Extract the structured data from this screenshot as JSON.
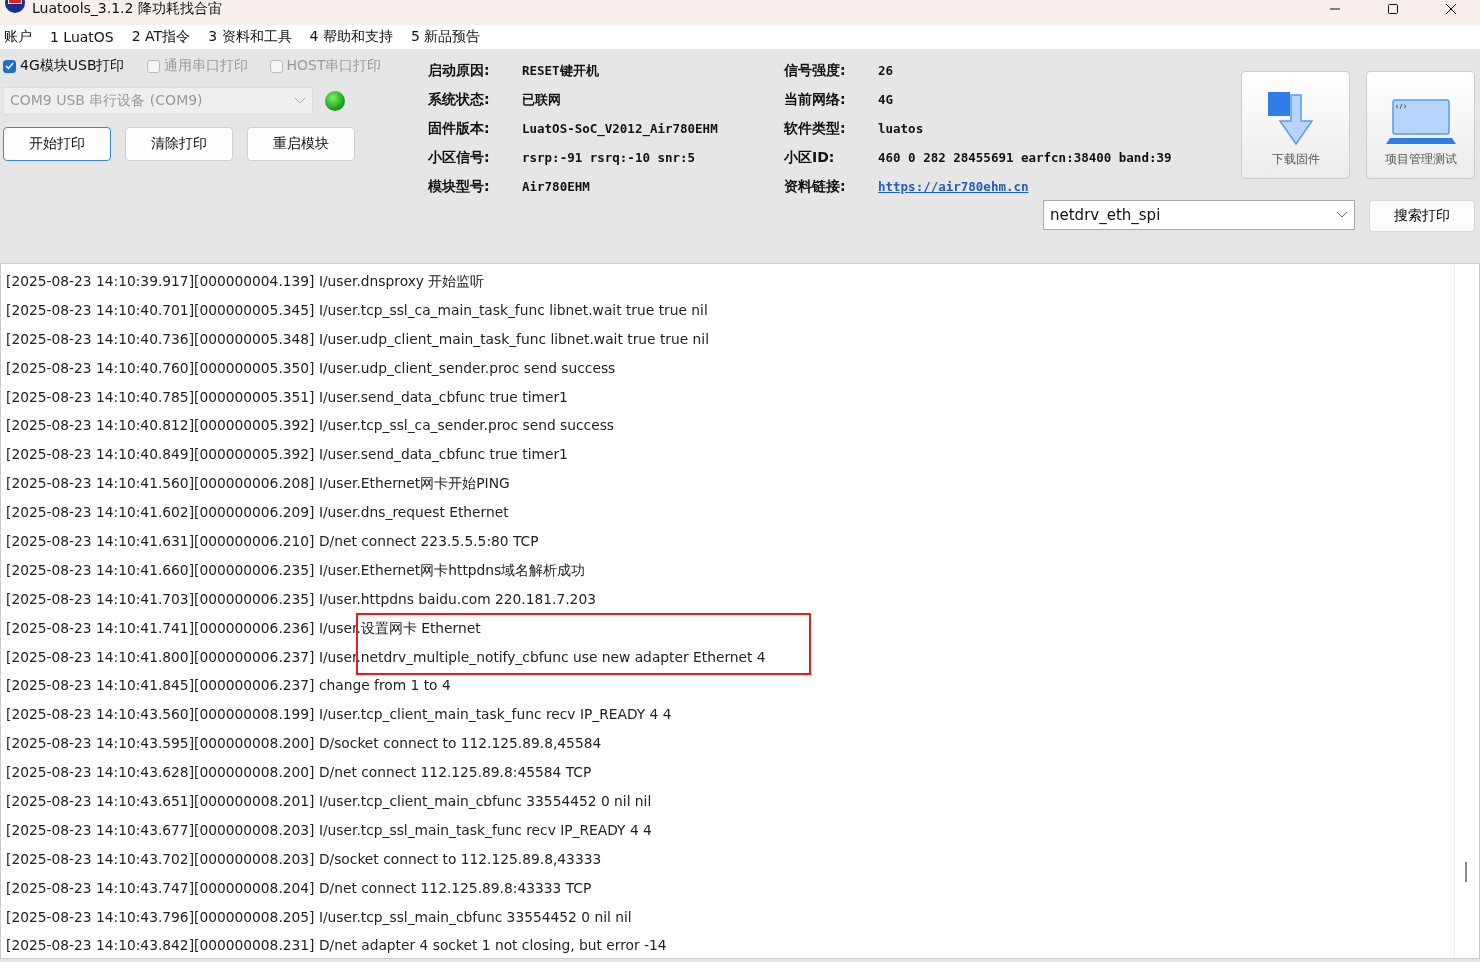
{
  "window": {
    "title": "Luatools_3.1.2 降功耗找合宙"
  },
  "menu": [
    "账户",
    "1 LuatOS",
    "2 AT指令",
    "3 资料和工具",
    "4 帮助和支持",
    "5 新品预告"
  ],
  "print_options": [
    {
      "label": "4G模块USB打印",
      "checked": true,
      "disabled": false
    },
    {
      "label": "通用串口打印",
      "checked": false,
      "disabled": true
    },
    {
      "label": "HOST串口打印",
      "checked": false,
      "disabled": true
    }
  ],
  "port_select": {
    "value": "COM9 USB 串行设备 (COM9)",
    "disabled": true
  },
  "connection_led": {
    "on": true
  },
  "buttons": [
    {
      "label": "开始打印",
      "selected": true
    },
    {
      "label": "清除打印",
      "selected": false
    },
    {
      "label": "重启模块",
      "selected": false
    }
  ],
  "info_left": [
    {
      "label": "启动原因:",
      "value": "RESET键开机"
    },
    {
      "label": "系统状态:",
      "value": "已联网"
    },
    {
      "label": "固件版本:",
      "value": "LuatOS-SoC_V2012_Air780EHM"
    },
    {
      "label": "小区信号:",
      "value": "rsrp:-91 rsrq:-10 snr:5"
    },
    {
      "label": "模块型号:",
      "value": "Air780EHM"
    }
  ],
  "info_right": [
    {
      "label": "信号强度:",
      "value": "26",
      "kind": "text"
    },
    {
      "label": "当前网络:",
      "value": "4G",
      "kind": "text"
    },
    {
      "label": "软件类型:",
      "value": "luatos",
      "kind": "text"
    },
    {
      "label": "小区ID:",
      "value": "460 0 282 28455691 earfcn:38400 band:39",
      "kind": "text"
    },
    {
      "label": "资料链接:",
      "value": "https://air780ehm.cn",
      "kind": "link"
    }
  ],
  "tool_buttons": [
    {
      "label": "下载固件",
      "kind": "download"
    },
    {
      "label": "项目管理测试",
      "kind": "laptop"
    }
  ],
  "search": {
    "value": "netdrv_eth_spi",
    "button": "搜索打印"
  },
  "log": [
    {
      "text": "[2025-08-23 14:10:39.917][000000004.139] I/user.dnsproxy 开始监听",
      "highlighted": false
    },
    {
      "text": "[2025-08-23 14:10:40.701][000000005.345] I/user.tcp_ssl_ca_main_task_func libnet.wait true true nil",
      "highlighted": false
    },
    {
      "text": "[2025-08-23 14:10:40.736][000000005.348] I/user.udp_client_main_task_func libnet.wait true true nil",
      "highlighted": false
    },
    {
      "text": "[2025-08-23 14:10:40.760][000000005.350] I/user.udp_client_sender.proc send success",
      "highlighted": false
    },
    {
      "text": "[2025-08-23 14:10:40.785][000000005.351] I/user.send_data_cbfunc true timer1",
      "highlighted": false
    },
    {
      "text": "[2025-08-23 14:10:40.812][000000005.392] I/user.tcp_ssl_ca_sender.proc send success",
      "highlighted": false
    },
    {
      "text": "[2025-08-23 14:10:40.849][000000005.392] I/user.send_data_cbfunc true timer1",
      "highlighted": false
    },
    {
      "text": "[2025-08-23 14:10:41.560][000000006.208] I/user.Ethernet网卡开始PING",
      "highlighted": false
    },
    {
      "text": "[2025-08-23 14:10:41.602][000000006.209] I/user.dns_request Ethernet",
      "highlighted": false
    },
    {
      "text": "[2025-08-23 14:10:41.631][000000006.210] D/net connect 223.5.5.5:80 TCP",
      "highlighted": false
    },
    {
      "text": "[2025-08-23 14:10:41.660][000000006.235] I/user.Ethernet网卡httpdns域名解析成功",
      "highlighted": false
    },
    {
      "text": "[2025-08-23 14:10:41.703][000000006.235] I/user.httpdns baidu.com 220.181.7.203",
      "highlighted": false
    },
    {
      "text": "[2025-08-23 14:10:41.741][000000006.236] I/user.设置网卡 Ethernet",
      "highlighted": true
    },
    {
      "text": "[2025-08-23 14:10:41.800][000000006.237] I/user.netdrv_multiple_notify_cbfunc use new adapter Ethernet 4",
      "highlighted": true
    },
    {
      "text": "[2025-08-23 14:10:41.845][000000006.237] change from 1 to 4",
      "highlighted": false
    },
    {
      "text": "[2025-08-23 14:10:43.560][000000008.199] I/user.tcp_client_main_task_func recv IP_READY 4 4",
      "highlighted": false
    },
    {
      "text": "[2025-08-23 14:10:43.595][000000008.200] D/socket connect to 112.125.89.8,45584",
      "highlighted": false
    },
    {
      "text": "[2025-08-23 14:10:43.628][000000008.200] D/net connect 112.125.89.8:45584 TCP",
      "highlighted": false
    },
    {
      "text": "[2025-08-23 14:10:43.651][000000008.201] I/user.tcp_client_main_cbfunc 33554452 0 nil nil",
      "highlighted": false
    },
    {
      "text": "[2025-08-23 14:10:43.677][000000008.203] I/user.tcp_ssl_main_task_func recv IP_READY 4 4",
      "highlighted": false
    },
    {
      "text": "[2025-08-23 14:10:43.702][000000008.203] D/socket connect to 112.125.89.8,43333",
      "highlighted": false
    },
    {
      "text": "[2025-08-23 14:10:43.747][000000008.204] D/net connect 112.125.89.8:43333 TCP",
      "highlighted": false
    },
    {
      "text": "[2025-08-23 14:10:43.796][000000008.205] I/user.tcp_ssl_main_cbfunc 33554452 0 nil nil",
      "highlighted": false
    },
    {
      "text": "[2025-08-23 14:10:43.842][000000008.231] D/net adapter 4 socket 1 not closing, but error -14",
      "highlighted": false
    }
  ]
}
